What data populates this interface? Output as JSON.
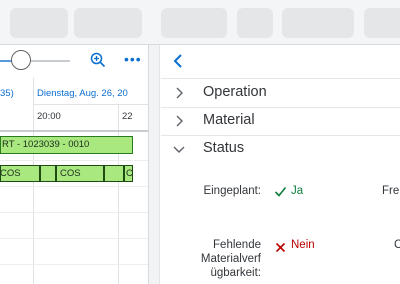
{
  "gantt": {
    "date_left": "35)",
    "date_right": "Dienstag, Aug. 26, 20",
    "time_1": "20:00",
    "time_2": "22",
    "order_bar": "RT - 1023039 - 0010",
    "ops": [
      "COS",
      "COS",
      "C"
    ]
  },
  "detail": {
    "sections": [
      {
        "label": "Operation",
        "expanded": false
      },
      {
        "label": "Material",
        "expanded": false
      },
      {
        "label": "Status",
        "expanded": true
      }
    ],
    "fields": {
      "eingeplant_label": "Eingeplant:",
      "eingeplant_value": "Ja",
      "fehlende_label_1": "Fehlende",
      "fehlende_label_2": "Materialverf",
      "fehlende_label_3": "ügbarkeit:",
      "fehlende_value": "Nein",
      "partial_label_right": "Fre",
      "partial_label_right_2": "C"
    }
  },
  "colors": {
    "accent": "#0a6ed1",
    "success": "#107e3e",
    "error": "#bb0000",
    "bar_green": "#a8e87f"
  }
}
